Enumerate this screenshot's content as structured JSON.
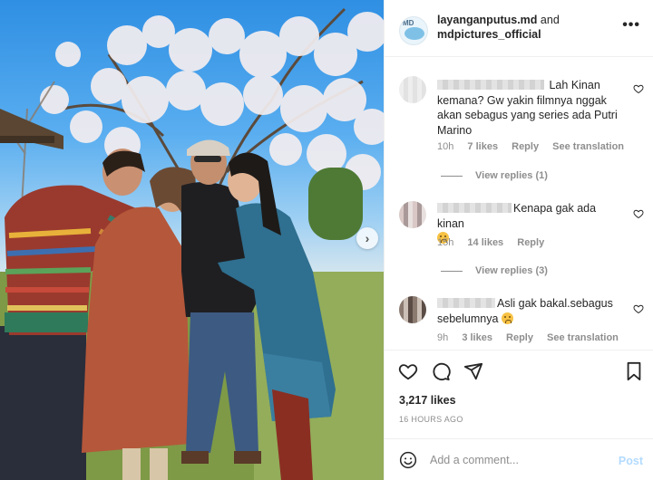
{
  "post": {
    "header": {
      "account1": "layanganputus.md",
      "conjunction": "and",
      "account2": "mdpictures_official",
      "avatar_logo": "MD",
      "more_icon": "ellipsis-icon"
    },
    "comments": [
      {
        "text": "Lah Kinan kemana? Gw yakin filmnya nggak akan sebagus yang series ada Putri Marino",
        "time": "10h",
        "likes": "7 likes",
        "reply": "Reply",
        "translate": "See translation",
        "view_replies": "View replies (1)"
      },
      {
        "text": "Kenapa gak ada kinan",
        "time": "15h",
        "likes": "14 likes",
        "reply": "Reply",
        "view_replies": "View replies (3)"
      },
      {
        "text": "Asli gak bakal.sebagus sebelumnya",
        "time": "9h",
        "likes": "3 likes",
        "reply": "Reply",
        "translate": "See translation"
      }
    ],
    "likes_count": "3,217 likes",
    "date": "16 HOURS AGO",
    "add_comment_placeholder": "Add a comment...",
    "post_label": "Post"
  },
  "colors": {
    "text": "#262626",
    "muted": "#8e8e8e",
    "border": "#efefef",
    "post_disabled": "#b3dbff"
  }
}
